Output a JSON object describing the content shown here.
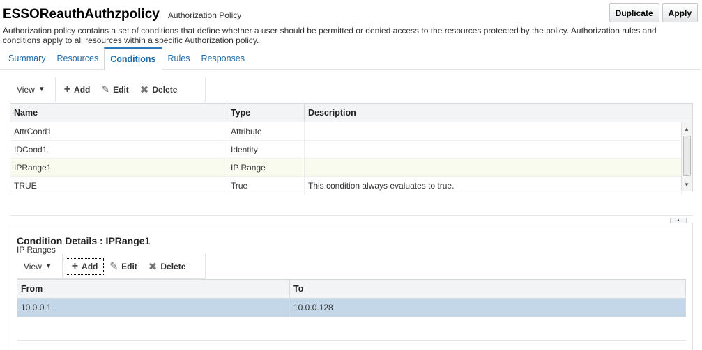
{
  "header": {
    "title": "ESSOReauthAuthzpolicy",
    "subtitle": "Authorization Policy",
    "duplicate_label": "Duplicate",
    "apply_label": "Apply",
    "description": "Authorization policy contains a set of conditions that define whether a user should be permitted or denied access to the resources protected by the policy. Authorization rules and conditions apply to all resources within a specific Authorization policy."
  },
  "tabs": [
    {
      "label": "Summary",
      "active": false
    },
    {
      "label": "Resources",
      "active": false
    },
    {
      "label": "Conditions",
      "active": true
    },
    {
      "label": "Rules",
      "active": false
    },
    {
      "label": "Responses",
      "active": false
    }
  ],
  "toolbar": {
    "view_label": "View",
    "add_label": "Add",
    "edit_label": "Edit",
    "delete_label": "Delete"
  },
  "conditions_table": {
    "columns": [
      "Name",
      "Type",
      "Description"
    ],
    "rows": [
      {
        "name": "AttrCond1",
        "type": "Attribute",
        "description": ""
      },
      {
        "name": "IDCond1",
        "type": "Identity",
        "description": ""
      },
      {
        "name": "IPRange1",
        "type": "IP Range",
        "description": ""
      },
      {
        "name": "TRUE",
        "type": "True",
        "description": "This condition always evaluates to true."
      }
    ],
    "highlighted_row": 2
  },
  "details": {
    "title": "Condition Details : IPRange1",
    "subtitle": "IP Ranges",
    "toolbar": {
      "view_label": "View",
      "add_label": "Add",
      "edit_label": "Edit",
      "delete_label": "Delete"
    },
    "table": {
      "columns": [
        "From",
        "To"
      ],
      "rows": [
        {
          "from": "10.0.0.1",
          "to": "10.0.0.128"
        }
      ],
      "selected_row": 0
    }
  },
  "colors": {
    "accent": "#2a7bbd",
    "link": "#1f6aa8",
    "selected_row": "#c3d7e8",
    "highlight_row": "#f9fbee"
  }
}
